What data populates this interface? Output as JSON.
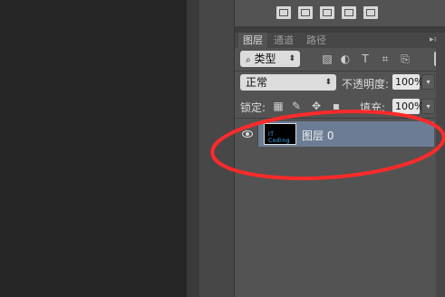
{
  "panel": {
    "tabs": [
      {
        "label": "图层",
        "active": true
      },
      {
        "label": "通道",
        "active": false
      },
      {
        "label": "路径",
        "active": false
      }
    ],
    "filter": {
      "search_icon": "search-icon",
      "label": "类型"
    },
    "blend_mode": "正常",
    "opacity_label": "不透明度:",
    "opacity_value": "100%",
    "lock_label": "锁定:",
    "fill_label": "填充:",
    "fill_value": "100%",
    "layers": [
      {
        "name": "图层 0",
        "thumb_text": "IT Coding",
        "visible": true,
        "selected": true
      }
    ]
  },
  "colors": {
    "selected_row": "#6c7c94",
    "annotation": "#ff2a2a"
  }
}
